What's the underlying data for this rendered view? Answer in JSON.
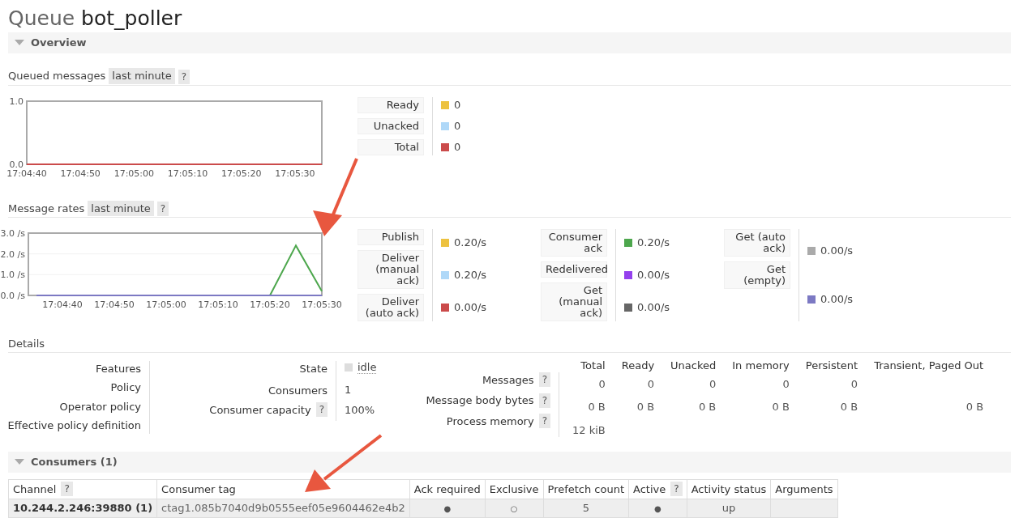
{
  "title": {
    "prefix": "Queue",
    "name": "bot_poller"
  },
  "overview": {
    "label": "Overview",
    "expanded": true
  },
  "queued_messages": {
    "label": "Queued messages",
    "range": "last minute",
    "help": "?",
    "chart_data": {
      "type": "line",
      "ylim": [
        0,
        1
      ],
      "yticks": [
        {
          "value": 0,
          "label": "0.0"
        },
        {
          "value": 1,
          "label": "1.0"
        }
      ],
      "categories": [
        "17:04:40",
        null,
        "17:04:50",
        null,
        "17:05:00",
        null,
        "17:05:10",
        null,
        "17:05:20",
        null,
        "17:05:30",
        null
      ],
      "series": [
        {
          "name": "Ready",
          "color": "#edc240",
          "values": [
            null,
            null,
            null,
            null,
            null,
            null,
            null,
            null,
            null,
            null,
            null,
            null
          ]
        },
        {
          "name": "Unacked",
          "color": "#afd8f8",
          "values": [
            null,
            null,
            null,
            null,
            null,
            null,
            null,
            null,
            null,
            null,
            null,
            null
          ]
        },
        {
          "name": "Total",
          "color": "#cb4b4b",
          "values": [
            0,
            0,
            0,
            0,
            0,
            0,
            0,
            0,
            0,
            0,
            0,
            0
          ]
        }
      ]
    },
    "readings": [
      "0",
      "0",
      "0"
    ]
  },
  "message_rates": {
    "label": "Message rates",
    "range": "last minute",
    "help": "?",
    "chart_data": {
      "type": "line",
      "ylim": [
        0,
        3
      ],
      "yticks": [
        {
          "value": 0,
          "label": "0.0 /s"
        },
        {
          "value": 1,
          "label": "1.0 /s"
        },
        {
          "value": 2,
          "label": "2.0 /s"
        },
        {
          "value": 3,
          "label": "3.0 /s"
        }
      ],
      "categories": [
        null,
        "17:04:40",
        null,
        "17:04:50",
        null,
        "17:05:00",
        null,
        "17:05:10",
        null,
        "17:05:20",
        null,
        "17:05:30"
      ],
      "series": [
        {
          "name": "Publish",
          "color": "#edc240",
          "values": [
            null,
            null,
            null,
            null,
            null,
            null,
            null,
            null,
            null,
            null,
            null,
            null
          ]
        },
        {
          "name": "Deliver (manual ack)",
          "color": "#afd8f8",
          "values": [
            null,
            null,
            null,
            null,
            null,
            null,
            null,
            null,
            null,
            null,
            null,
            null
          ]
        },
        {
          "name": "Deliver (auto ack)",
          "color": "#cb4b4b",
          "values": [
            null,
            null,
            null,
            null,
            null,
            null,
            null,
            null,
            null,
            null,
            null,
            null
          ]
        },
        {
          "name": "Consumer ack",
          "color": "#4da74d",
          "values": [
            null,
            null,
            null,
            null,
            null,
            null,
            null,
            null,
            null,
            0,
            2.4,
            0.2
          ]
        },
        {
          "name": "Redelivered",
          "color": "#9440ed",
          "values": [
            null,
            null,
            null,
            null,
            null,
            null,
            null,
            null,
            null,
            null,
            null,
            null
          ]
        },
        {
          "name": "Get (manual ack)",
          "color": "#666666",
          "values": [
            null,
            null,
            null,
            null,
            null,
            null,
            null,
            null,
            null,
            null,
            null,
            null
          ]
        },
        {
          "name": "Get (auto ack)",
          "color": "#aaaaaa",
          "values": [
            null,
            null,
            null,
            null,
            null,
            null,
            null,
            null,
            null,
            null,
            null,
            null
          ]
        },
        {
          "name": "Get (empty)",
          "color": "#7c79c3",
          "values": [
            0,
            0,
            0,
            0,
            0,
            0,
            0,
            0,
            0,
            0,
            0,
            0
          ]
        }
      ]
    },
    "readings": [
      "0.20/s",
      "0.20/s",
      "0.00/s",
      "0.20/s",
      "0.00/s",
      "0.00/s",
      "0.00/s",
      "0.00/s"
    ]
  },
  "details": {
    "label": "Details",
    "policy_labels": [
      "Features",
      "Policy",
      "Operator policy",
      "Effective policy definition"
    ],
    "state": {
      "label": "State",
      "value": "idle"
    },
    "consumers": {
      "label": "Consumers",
      "value": "1"
    },
    "consumer_capacity": {
      "label": "Consumer capacity",
      "help": "?",
      "value": "100%"
    },
    "stats_columns": [
      "Total",
      "Ready",
      "Unacked",
      "In memory",
      "Persistent",
      "Transient, Paged Out"
    ],
    "stats_rows": [
      {
        "label": "Messages",
        "help": "?",
        "cells": [
          "0",
          "0",
          "0",
          "0",
          "0",
          ""
        ]
      },
      {
        "label": "Message body bytes",
        "help": "?",
        "cells": [
          "0 B",
          "0 B",
          "0 B",
          "0 B",
          "0 B",
          "0 B"
        ]
      },
      {
        "label": "Process memory",
        "help": "?",
        "cells": [
          "12 kiB",
          "",
          "",
          "",
          "",
          ""
        ]
      }
    ]
  },
  "consumers": {
    "label": "Consumers (1)",
    "expanded": true,
    "columns": [
      {
        "label": "Channel",
        "help": "?"
      },
      {
        "label": "Consumer tag"
      },
      {
        "label": "Ack required"
      },
      {
        "label": "Exclusive"
      },
      {
        "label": "Prefetch count"
      },
      {
        "label": "Active",
        "help": "?"
      },
      {
        "label": "Activity status"
      },
      {
        "label": "Arguments"
      }
    ],
    "rows": [
      {
        "channel": "10.244.2.246:39880 (1)",
        "consumer_tag": "ctag1.085b7040d9b0555eef05e9604462e4b2",
        "ack_required": "●",
        "exclusive": "○",
        "prefetch_count": "5",
        "active": "●",
        "activity_status": "up"
      }
    ]
  }
}
